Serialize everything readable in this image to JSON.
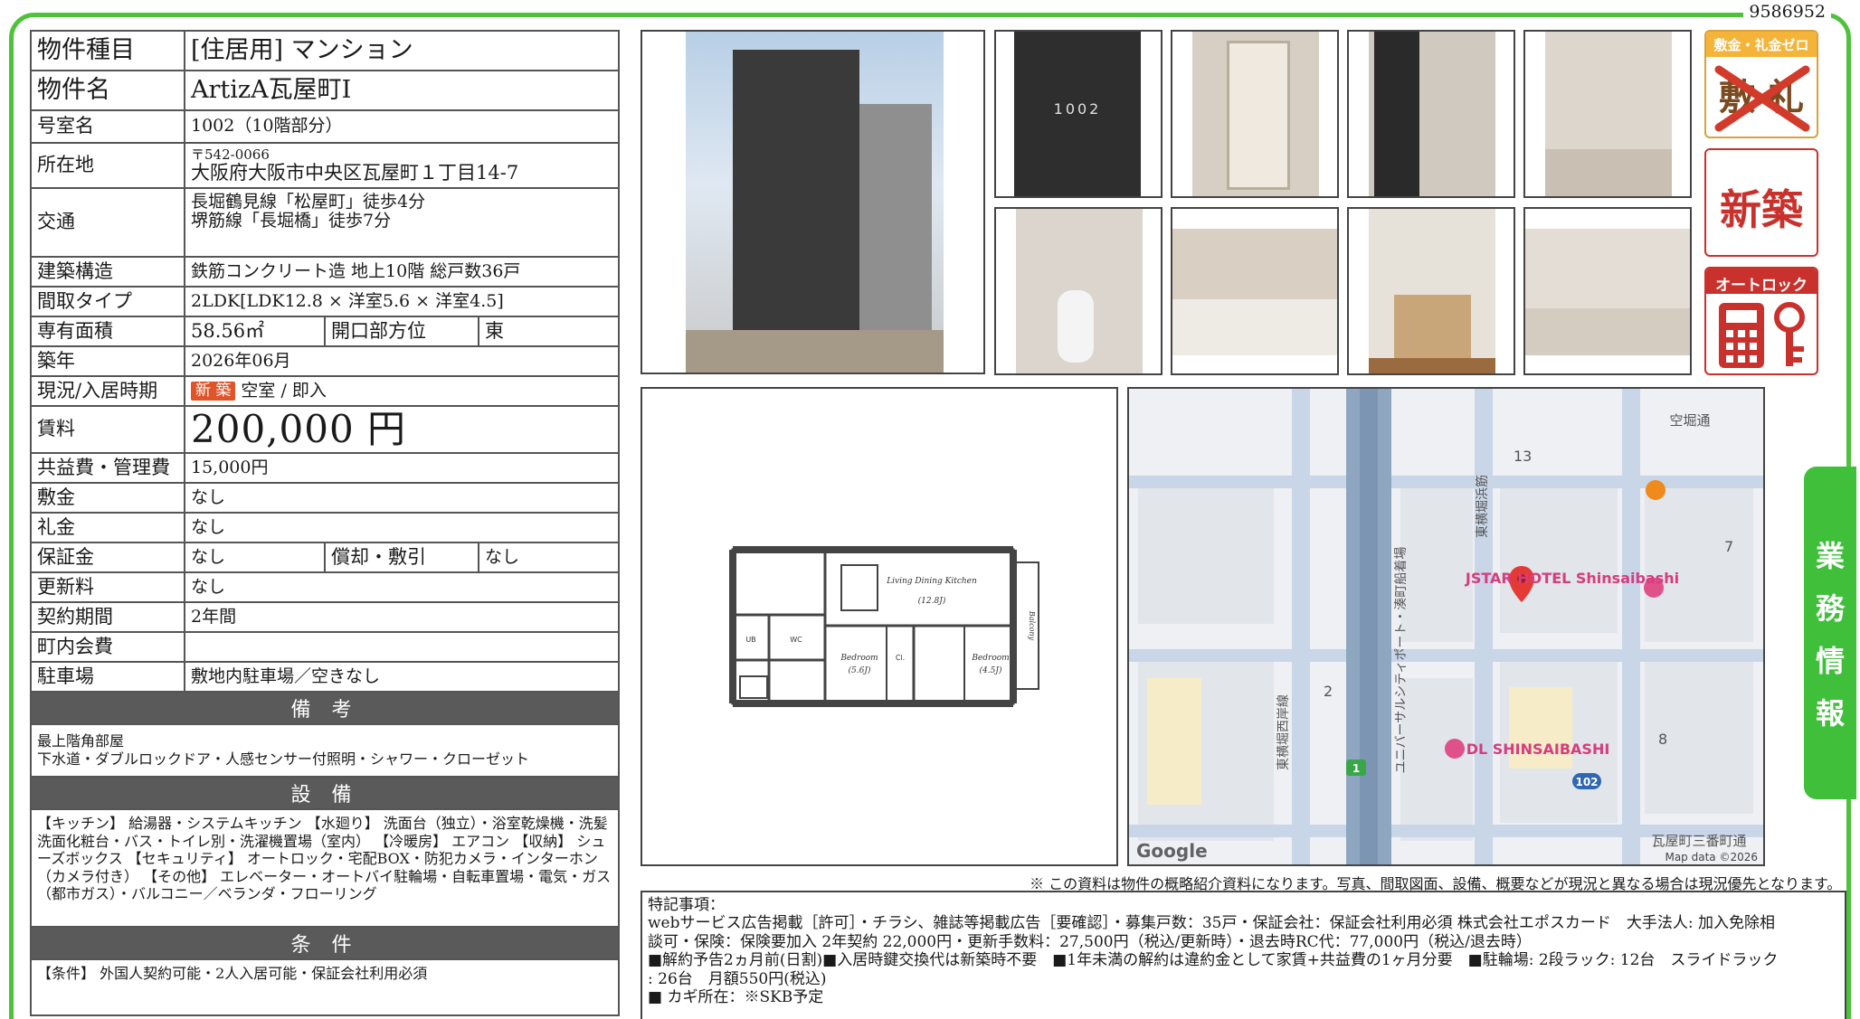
{
  "doc_id": "9586952",
  "spec": {
    "type_label": "物件種目",
    "type_value": "[住居用] マンション",
    "name_label": "物件名",
    "name_value": "ArtizA瓦屋町I",
    "room_label": "号室名",
    "room_value": "1002（10階部分）",
    "address_label": "所在地",
    "address_zip": "〒542-0066",
    "address_value": "大阪府大阪市中央区瓦屋町１丁目14-7",
    "transport_label": "交通",
    "transport_1": "長堀鶴見線「松屋町」徒歩4分",
    "transport_2": "堺筋線「長堀橋」徒歩7分",
    "structure_label": "建築構造",
    "structure_value": "鉄筋コンクリート造 地上10階 総戸数36戸",
    "layout_label": "間取タイプ",
    "layout_value": "2LDK[LDK12.8 × 洋室5.6 × 洋室4.5]",
    "area_label": "専有面積",
    "area_value": "58.56㎡",
    "direction_label": "開口部方位",
    "direction_value": "東",
    "built_label": "築年",
    "built_value": "2026年06月",
    "status_label": "現況/入居時期",
    "status_badge": "新 築",
    "status_value": "空室 / 即入",
    "rent_label": "賃料",
    "rent_value": "200,000 円",
    "fee_label": "共益費・管理費",
    "fee_value": "15,000円",
    "deposit_label": "敷金",
    "deposit_value": "なし",
    "key_money_label": "礼金",
    "key_money_value": "なし",
    "guarantee_label": "保証金",
    "guarantee_value": "なし",
    "amort_label": "償却・敷引",
    "amort_value": "なし",
    "renewal_label": "更新料",
    "renewal_value": "なし",
    "contract_label": "契約期間",
    "contract_value": "2年間",
    "community_label": "町内会費",
    "community_value": "",
    "parking_label": "駐車場",
    "parking_value": "敷地内駐車場／空きなし"
  },
  "remarks": {
    "title": "備 考",
    "line1": "最上階角部屋",
    "line2": "下水道・ダブルロックドア・人感センサー付照明・シャワー・クローゼット"
  },
  "equipment": {
    "title": "設 備",
    "text": "【キッチン】 給湯器・システムキッチン 【水廻り】 洗面台（独立）・浴室乾燥機・洗髪洗面化粧台・バス・トイレ別・洗濯機置場（室内） 【冷暖房】 エアコン 【収納】 シューズボックス 【セキュリティ】 オートロック・宅配BOX・防犯カメラ・インターホン（カメラ付き） 【その他】 エレベーター・オートバイ駐輪場・自転車置場・電気・ガス（都市ガス）・バルコニー／ベランダ・フローリング"
  },
  "conditions": {
    "title": "条 件",
    "text": "【条件】 外国人契約可能・2人入居可能・保証会社利用必須"
  },
  "photos": {
    "door_number": "1002"
  },
  "badges": {
    "zero_title": "敷金・礼金ゼロ",
    "zero_chars": "敷 礼",
    "new": "新築",
    "autolock": "オートロック"
  },
  "floorplan": {
    "ldk": "Living Dining Kitchen",
    "ldk_size": "(12.8J)",
    "bed1": "Bedroom",
    "bed1_size": "(5.6J)",
    "bed2": "Bedroom",
    "bed2_size": "(4.5J)",
    "balcony": "Balcony",
    "ub": "UB",
    "wc": "WC",
    "cl": "Cl."
  },
  "map": {
    "hotel1": "JSTAR HOTEL Shinsaibashi",
    "hotel2": "DL SHINSAIBASHI",
    "road1": "東横堀西岸線",
    "road2": "ユニバーサルシティポート・湊町船着場",
    "road3": "東横堀浜筋",
    "road4": "空堀通",
    "road5": "瓦屋町三番町通",
    "n13": "13",
    "n7": "7",
    "n2": "2",
    "n8": "8",
    "n1": "1",
    "n102": "102",
    "google": "Google",
    "credit": "Map data ©2026"
  },
  "disclaimer": "※ この資料は物件の概略紹介資料になります。写真、間取図面、設備、概要などが現況と異なる場合は現況優先となります。",
  "notes": {
    "title": "特記事項：",
    "line1": "webサービス広告掲載［許可］・チラシ、雑誌等掲載広告［要確認］・募集戸数：35戸・保証会社：保証会社利用必須 株式会社エポスカード　大手法人: 加入免除相",
    "line2": "談可・保険：保険要加入 2年契約 22,000円・更新手数料：27,500円（税込/更新時）・退去時RC代：77,000円（税込/退去時）",
    "line3": "■解約予告2ヵ月前(日割)■入居時鍵交換代は新築時不要　■1年未満の解約は違約金として家賃+共益費の1ヶ月分要　■駐輪場: 2段ラック: 12台　スライドラック",
    "line4": ": 26台　月額550円(税込)",
    "line5": "■ カギ所在：※SKB予定"
  },
  "side_tab": [
    "業",
    "務",
    "情",
    "報"
  ]
}
